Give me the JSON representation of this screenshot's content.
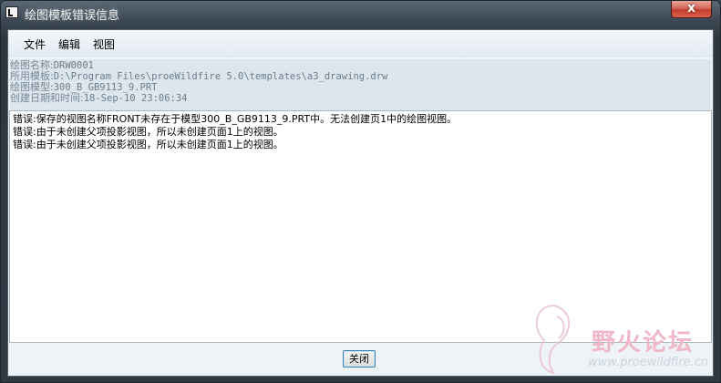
{
  "window": {
    "title": "绘图模板错误信息",
    "close_glyph": "x"
  },
  "menu": [
    {
      "label": "文件"
    },
    {
      "label": "编辑"
    },
    {
      "label": "视图"
    }
  ],
  "info": [
    {
      "label": "绘图名称:",
      "value": "DRW0001"
    },
    {
      "label": "所用模板:",
      "value": "D:\\Program Files\\proeWildfire 5.0\\templates\\a3_drawing.drw"
    },
    {
      "label": "绘图模型:",
      "value": "300_B_GB9113_9.PRT"
    },
    {
      "label": "创建日期和时间:",
      "value": "18-Sep-10 23:06:34"
    }
  ],
  "errors": [
    "错误:保存的视图名称FRONT未存在于模型300_B_GB9113_9.PRT中。无法创建页1中的绘图视图。",
    "错误:由于未创建父项投影视图，所以未创建页面1上的视图。",
    "错误:由于未创建父项投影视图，所以未创建页面1上的视图。"
  ],
  "buttons": {
    "close_label": "关闭"
  },
  "watermark": {
    "text": "野火论坛",
    "url": "www.proewildfire.cn"
  },
  "colors": {
    "titlebar": "#3b4752",
    "close_button": "#c33c2b",
    "info_bg": "#dbe6ee",
    "button_border": "#3c7fb1"
  }
}
